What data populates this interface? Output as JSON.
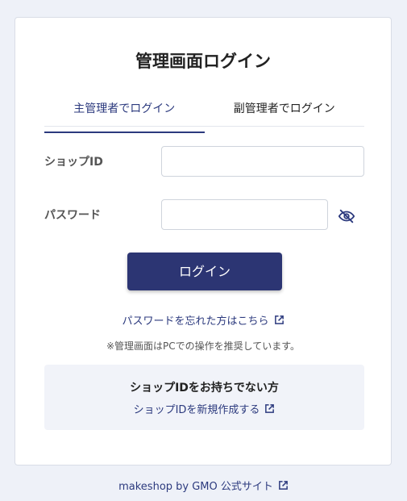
{
  "title": "管理画面ログイン",
  "tabs": [
    {
      "label": "主管理者でログイン",
      "active": true
    },
    {
      "label": "副管理者でログイン",
      "active": false
    }
  ],
  "form": {
    "shop_id_label": "ショップID",
    "shop_id_value": "",
    "password_label": "パスワード",
    "password_value": ""
  },
  "login_button": "ログイン",
  "forgot_link": "パスワードを忘れた方はこちら",
  "note": "※管理画面はPCでの操作を推奨しています。",
  "no_id": {
    "title": "ショップIDをお持ちでない方",
    "link": "ショップIDを新規作成する"
  },
  "footer_link": "makeshop by GMO 公式サイト",
  "colors": {
    "accent": "#2c3573",
    "link": "#2c3a7e",
    "background": "#eef1f8"
  },
  "icons": {
    "password_toggle": "eye-slash-icon",
    "external": "external-link-icon"
  }
}
